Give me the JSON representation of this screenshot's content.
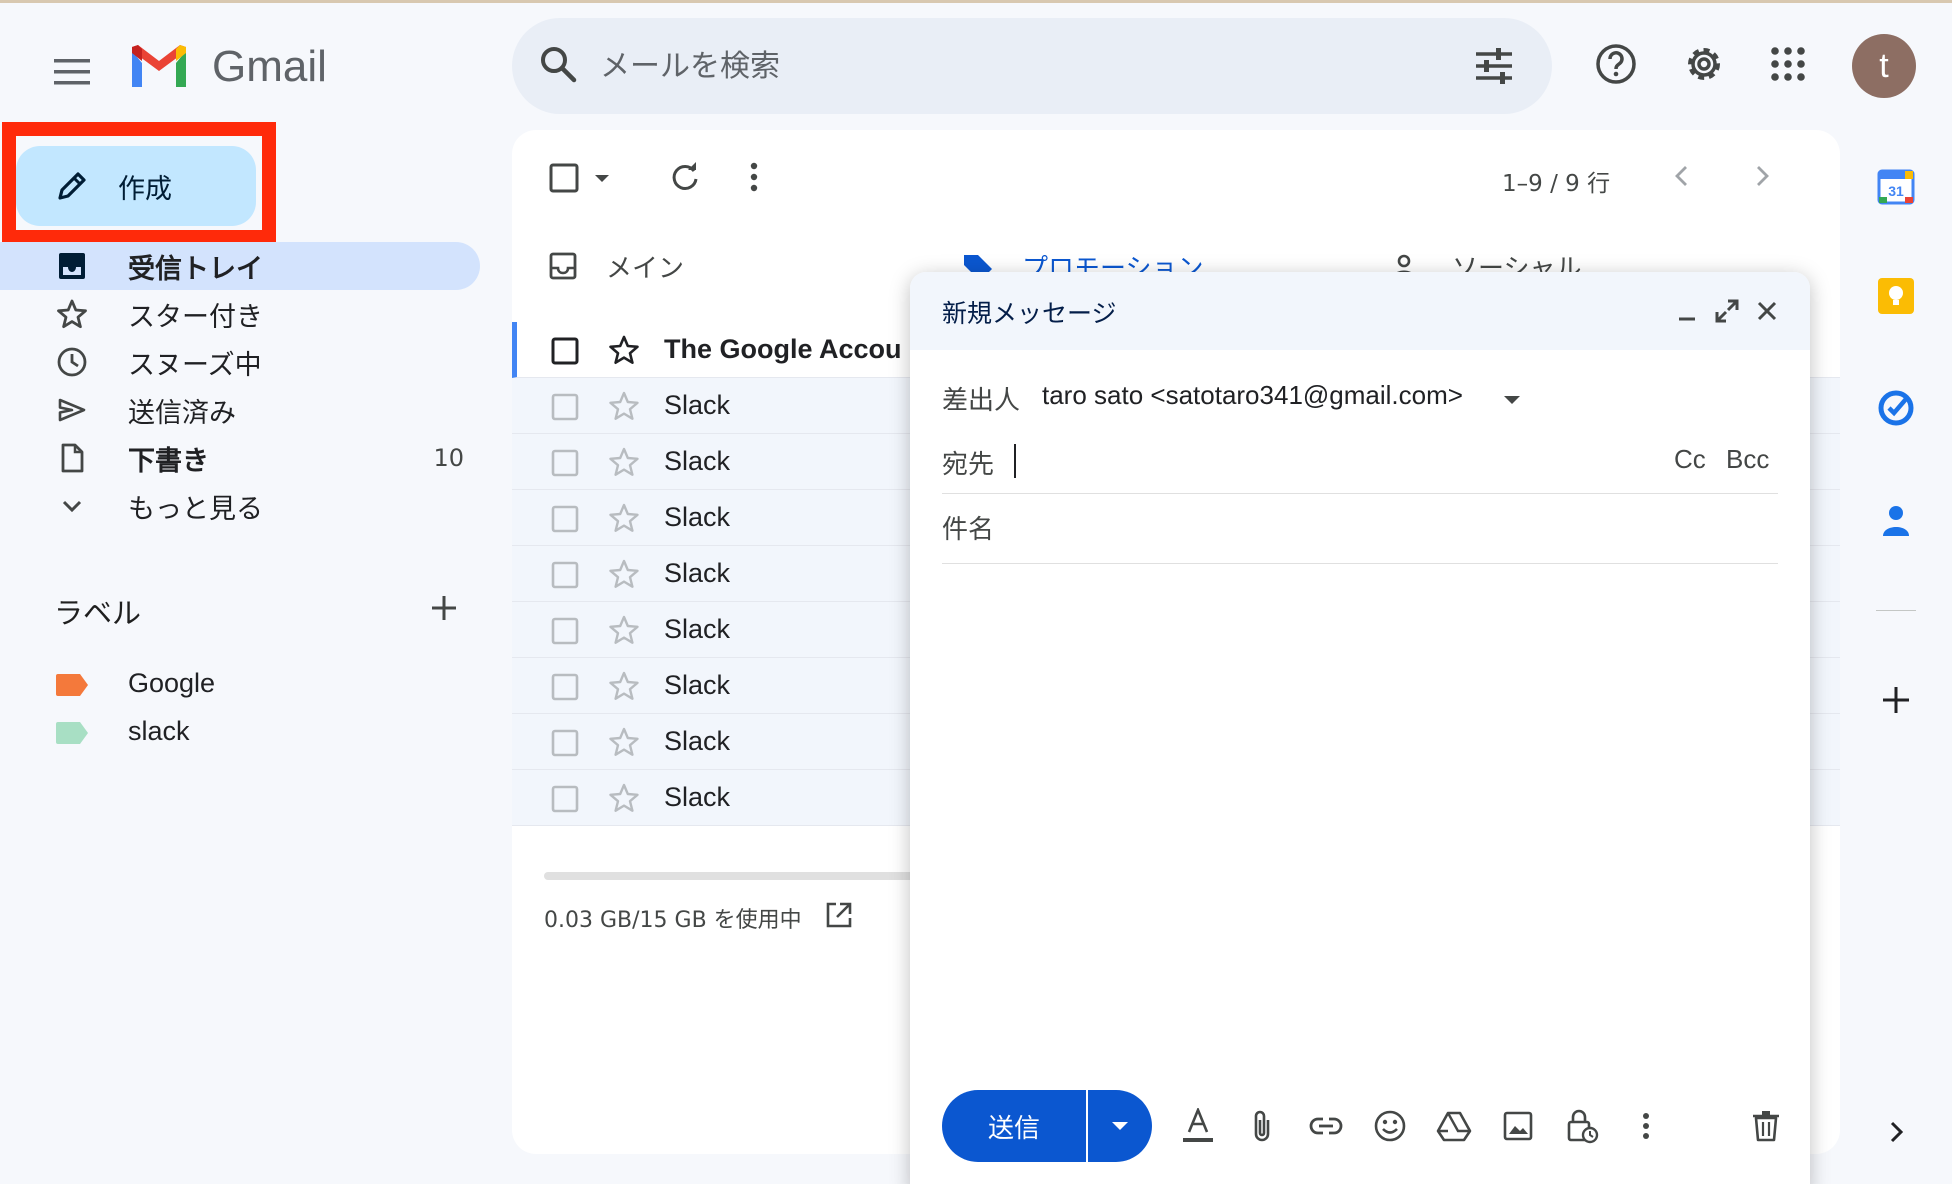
{
  "app": {
    "logo_text": "Gmail"
  },
  "search": {
    "placeholder": "メールを検索"
  },
  "header": {
    "avatar_letter": "t"
  },
  "compose": {
    "label": "作成"
  },
  "nav": [
    {
      "label": "受信トレイ",
      "icon": "inbox-icon",
      "active": true,
      "bold": true,
      "count": ""
    },
    {
      "label": "スター付き",
      "icon": "star-icon",
      "active": false,
      "bold": false,
      "count": ""
    },
    {
      "label": "スヌーズ中",
      "icon": "clock-icon",
      "active": false,
      "bold": false,
      "count": ""
    },
    {
      "label": "送信済み",
      "icon": "send-icon",
      "active": false,
      "bold": false,
      "count": ""
    },
    {
      "label": "下書き",
      "icon": "draft-icon",
      "active": false,
      "bold": true,
      "count": "10"
    },
    {
      "label": "もっと見る",
      "icon": "chevron-down-icon",
      "active": false,
      "bold": false,
      "count": ""
    }
  ],
  "labels": {
    "title": "ラベル",
    "items": [
      {
        "name": "Google",
        "color": "#f4793b"
      },
      {
        "name": "slack",
        "color": "#a8dfc4"
      }
    ]
  },
  "toolbar": {
    "pager": "1–9 / 9 行"
  },
  "tabs": [
    {
      "label": "メイン"
    },
    {
      "label": "プロモーション"
    },
    {
      "label": "ソーシャル"
    }
  ],
  "emails": [
    {
      "sender": "The Google Accou"
    },
    {
      "sender": "Slack"
    },
    {
      "sender": "Slack"
    },
    {
      "sender": "Slack"
    },
    {
      "sender": "Slack"
    },
    {
      "sender": "Slack"
    },
    {
      "sender": "Slack"
    },
    {
      "sender": "Slack"
    },
    {
      "sender": "Slack"
    }
  ],
  "storage": {
    "text": "0.03 GB/15 GB を使用中"
  },
  "dialog": {
    "title": "新規メッセージ",
    "from_label": "差出人",
    "from_value": "taro sato <satotaro341@gmail.com>",
    "to_label": "宛先",
    "to_value": "",
    "cc": "Cc",
    "bcc": "Bcc",
    "subject_placeholder": "件名",
    "send_label": "送信"
  },
  "colors": {
    "accent": "#0b57d0",
    "compose_bg": "#c2e7ff",
    "active_nav": "#d3e3fd",
    "highlight_box": "#ff2a0a"
  }
}
